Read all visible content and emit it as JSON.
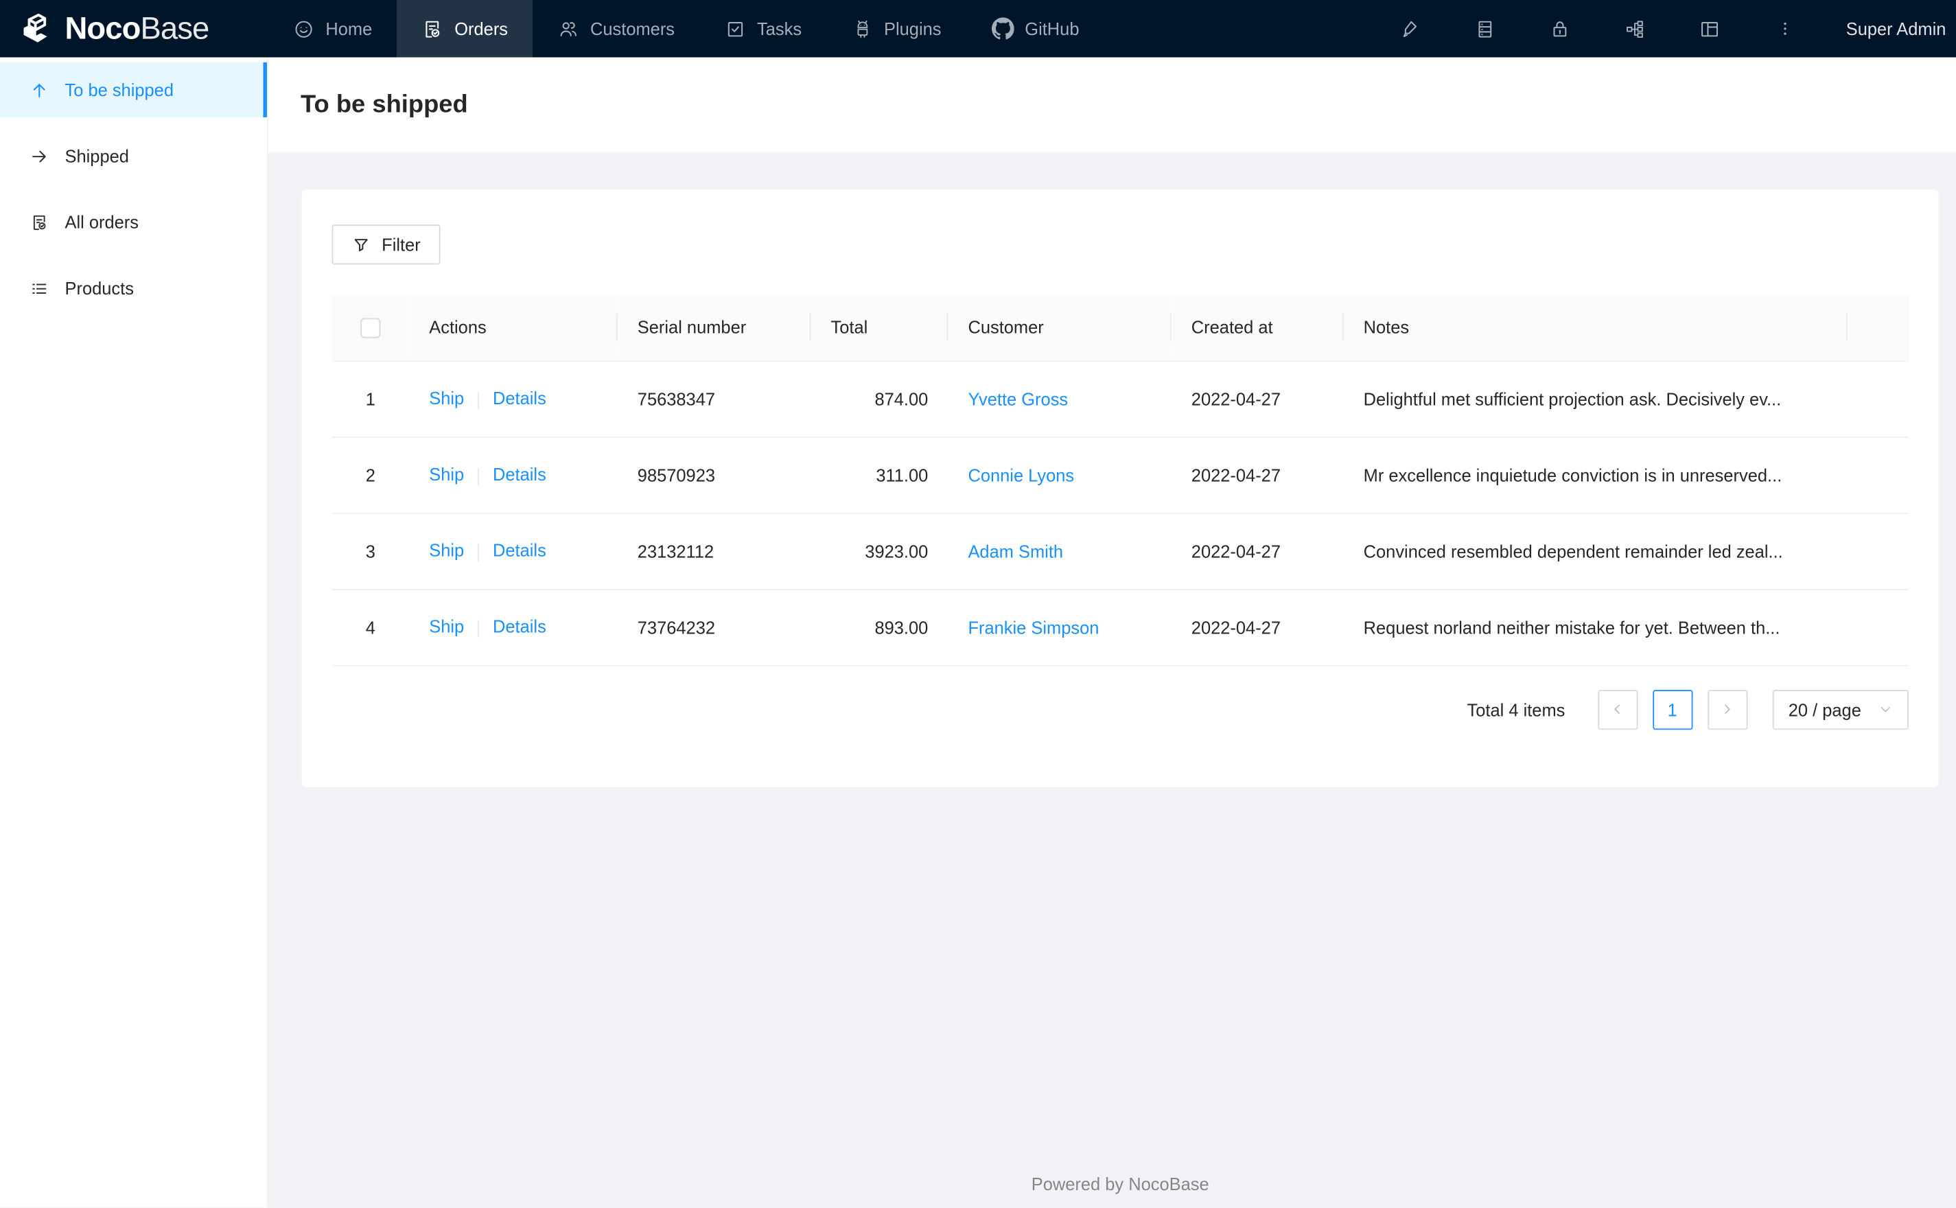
{
  "nav": {
    "logo": {
      "text_bold": "Noco",
      "text_light": "Base"
    },
    "items": [
      {
        "label": "Home",
        "icon": "smile-icon",
        "active": false
      },
      {
        "label": "Orders",
        "icon": "file-done-icon",
        "active": true
      },
      {
        "label": "Customers",
        "icon": "team-icon",
        "active": false
      },
      {
        "label": "Tasks",
        "icon": "check-square-icon",
        "active": false
      },
      {
        "label": "Plugins",
        "icon": "robot-icon",
        "active": false
      },
      {
        "label": "GitHub",
        "icon": "github-icon",
        "active": false
      }
    ],
    "right_icons": [
      "highlight-icon",
      "database-icon",
      "lock-icon",
      "partition-icon",
      "layout-icon",
      "ellipsis-icon"
    ],
    "user": "Super Admin"
  },
  "sidebar": {
    "items": [
      {
        "label": "To be shipped",
        "icon": "arrow-up-icon",
        "active": true
      },
      {
        "label": "Shipped",
        "icon": "arrow-right-icon",
        "active": false
      },
      {
        "label": "All orders",
        "icon": "file-done-icon",
        "active": false
      },
      {
        "label": "Products",
        "icon": "list-icon",
        "active": false
      }
    ]
  },
  "page": {
    "title": "To be shipped"
  },
  "toolbar": {
    "filter_label": "Filter"
  },
  "table": {
    "columns": [
      "",
      "Actions",
      "Serial number",
      "Total",
      "Customer",
      "Created at",
      "Notes"
    ],
    "action_labels": {
      "ship": "Ship",
      "details": "Details"
    },
    "rows": [
      {
        "index": "1",
        "serial": "75638347",
        "total": "874.00",
        "customer": "Yvette Gross",
        "created_at": "2022-04-27",
        "notes": "Delightful met sufficient projection ask. Decisively ev..."
      },
      {
        "index": "2",
        "serial": "98570923",
        "total": "311.00",
        "customer": "Connie Lyons",
        "created_at": "2022-04-27",
        "notes": "Mr excellence inquietude conviction is in unreserved..."
      },
      {
        "index": "3",
        "serial": "23132112",
        "total": "3923.00",
        "customer": "Adam Smith",
        "created_at": "2022-04-27",
        "notes": "Convinced resembled dependent remainder led zeal..."
      },
      {
        "index": "4",
        "serial": "73764232",
        "total": "893.00",
        "customer": "Frankie Simpson",
        "created_at": "2022-04-27",
        "notes": "Request norland neither mistake for yet. Between th..."
      }
    ]
  },
  "pagination": {
    "total_text": "Total 4 items",
    "current_page": "1",
    "page_size": "20 / page"
  },
  "footer": {
    "text": "Powered by NocoBase"
  },
  "colors": {
    "accent": "#1890ff",
    "header_bg": "#001529",
    "content_bg": "#f0f2f5",
    "sidebar_active_bg": "#e6f7ff",
    "table_header_bg": "#fafafa",
    "border": "#f0f0f0"
  }
}
